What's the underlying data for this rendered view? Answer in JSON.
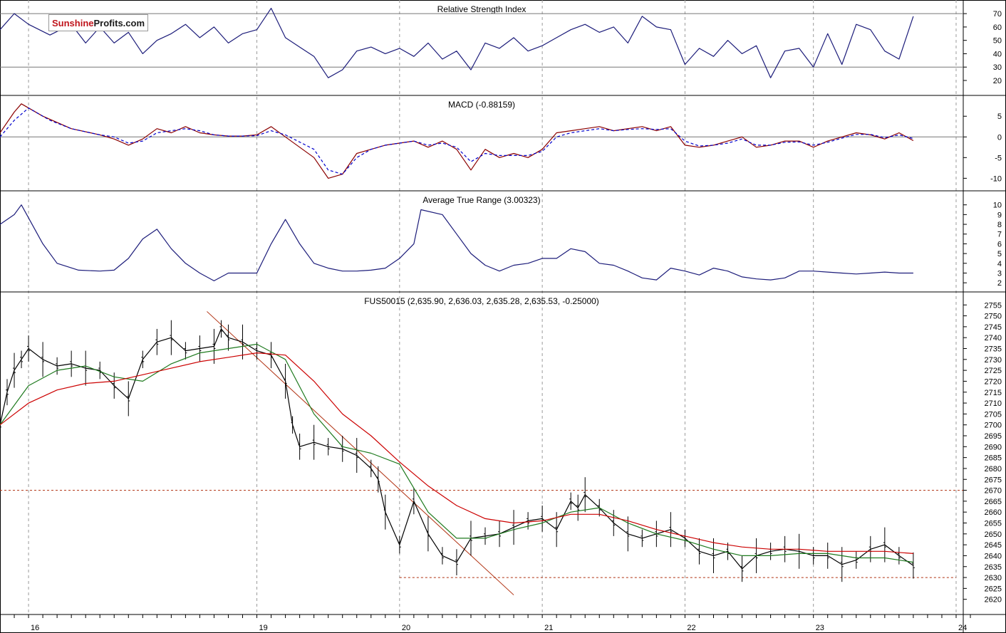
{
  "brand": {
    "logo_part1": "Sunshine",
    "logo_part2": "Profits.com"
  },
  "colors": {
    "rsi_line": "#1c1c7a",
    "macd_line": "#8b0000",
    "signal_line": "#0000cc",
    "atr_line": "#1c1c7a",
    "price_bars": "#000000",
    "ma_short": "#1e7a1e",
    "ma_long": "#cc0000",
    "trendline": "#b03010",
    "support": "#b03010",
    "grid": "#9a9a9a"
  },
  "x_axis": {
    "day_labels": [
      "16",
      "19",
      "20",
      "21",
      "22",
      "23",
      "24"
    ],
    "day_positions": [
      0.2,
      1.8,
      2.8,
      3.8,
      4.8,
      5.7,
      6.7
    ]
  },
  "chart_data": [
    {
      "type": "line",
      "title": "Relative Strength Index",
      "ylim": [
        12,
        77
      ],
      "yticks": [
        70,
        60,
        50,
        40,
        30,
        20
      ],
      "reference_lines": [
        70,
        30
      ],
      "series": [
        {
          "x": [
            0.0,
            0.1,
            0.2,
            0.35,
            0.5,
            0.6,
            0.7,
            0.8,
            0.9,
            1.0,
            1.1,
            1.2,
            1.3,
            1.4,
            1.5,
            1.6,
            1.7,
            1.8,
            1.9,
            2.0,
            2.1,
            2.2,
            2.3,
            2.4,
            2.5,
            2.6,
            2.7,
            2.8,
            2.9,
            3.0,
            3.1,
            3.2,
            3.3,
            3.4,
            3.5,
            3.6,
            3.7,
            3.8,
            3.9,
            4.0,
            4.1,
            4.2,
            4.3,
            4.4,
            4.5,
            4.6,
            4.7,
            4.8,
            4.9,
            5.0,
            5.1,
            5.2,
            5.3,
            5.4,
            5.5,
            5.6,
            5.7,
            5.8,
            5.9,
            6.0,
            6.1,
            6.2,
            6.3,
            6.4
          ],
          "values": [
            58,
            70,
            62,
            54,
            62,
            48,
            60,
            48,
            56,
            40,
            50,
            55,
            62,
            52,
            60,
            48,
            55,
            58,
            74,
            52,
            45,
            38,
            22,
            28,
            42,
            45,
            40,
            44,
            38,
            48,
            36,
            42,
            28,
            48,
            44,
            52,
            42,
            46,
            52,
            58,
            62,
            56,
            60,
            48,
            68,
            60,
            58,
            32,
            44,
            38,
            50,
            40,
            46,
            22,
            42,
            44,
            30,
            55,
            32,
            62,
            58,
            42,
            36,
            68
          ]
        }
      ]
    },
    {
      "type": "line",
      "title": "MACD (-0.88159)",
      "ylim": [
        -12,
        9
      ],
      "yticks": [
        5,
        0,
        -5,
        -10
      ],
      "reference_lines": [
        0
      ],
      "series": [
        {
          "x": [
            0.0,
            0.1,
            0.15,
            0.3,
            0.5,
            0.7,
            0.8,
            0.9,
            1.0,
            1.1,
            1.2,
            1.3,
            1.4,
            1.5,
            1.6,
            1.7,
            1.8,
            1.9,
            2.0,
            2.2,
            2.3,
            2.4,
            2.5,
            2.6,
            2.7,
            2.8,
            2.9,
            3.0,
            3.1,
            3.2,
            3.3,
            3.4,
            3.5,
            3.6,
            3.7,
            3.8,
            3.9,
            4.0,
            4.1,
            4.2,
            4.3,
            4.4,
            4.5,
            4.6,
            4.7,
            4.8,
            4.9,
            5.0,
            5.1,
            5.2,
            5.3,
            5.4,
            5.5,
            5.6,
            5.7,
            5.8,
            5.9,
            6.0,
            6.1,
            6.2,
            6.3,
            6.4
          ],
          "values": [
            1,
            6,
            8,
            5,
            2,
            0.5,
            -0.5,
            -2,
            -0.5,
            2,
            1,
            2.5,
            1,
            0.5,
            0.2,
            0.2,
            0.5,
            2.5,
            0,
            -5,
            -10,
            -9,
            -4,
            -3,
            -2,
            -1.5,
            -1,
            -2.5,
            -1,
            -3,
            -8,
            -3,
            -5,
            -4,
            -5,
            -3,
            1,
            1.5,
            2,
            2.5,
            1.5,
            2,
            2.5,
            1.5,
            2.5,
            -2,
            -2.5,
            -2,
            -1,
            0,
            -2.5,
            -2,
            -1,
            -1,
            -2.5,
            -1,
            0,
            1,
            0.5,
            -0.5,
            1,
            -0.9
          ]
        },
        {
          "x": [
            0.0,
            0.1,
            0.2,
            0.35,
            0.5,
            0.7,
            0.8,
            0.9,
            1.0,
            1.1,
            1.2,
            1.3,
            1.4,
            1.5,
            1.6,
            1.7,
            1.8,
            1.9,
            2.0,
            2.2,
            2.3,
            2.4,
            2.5,
            2.6,
            2.7,
            2.8,
            2.9,
            3.0,
            3.1,
            3.2,
            3.3,
            3.4,
            3.5,
            3.6,
            3.7,
            3.8,
            3.9,
            4.0,
            4.1,
            4.2,
            4.3,
            4.4,
            4.5,
            4.6,
            4.7,
            4.8,
            4.9,
            5.0,
            5.1,
            5.2,
            5.3,
            5.4,
            5.5,
            5.6,
            5.7,
            5.8,
            5.9,
            6.0,
            6.1,
            6.2,
            6.3,
            6.4
          ],
          "values": [
            0,
            4,
            7,
            4,
            2,
            0.5,
            0,
            -1.5,
            -1,
            1,
            1.5,
            2,
            1.5,
            0.5,
            0.2,
            0.2,
            0.3,
            1.5,
            0.5,
            -3,
            -8,
            -9,
            -5,
            -3,
            -2,
            -1.5,
            -1,
            -2,
            -1.5,
            -2.5,
            -6,
            -4,
            -4.5,
            -4.5,
            -4.5,
            -3.5,
            0,
            1,
            1.5,
            2,
            1.5,
            1.8,
            2,
            1.8,
            2,
            -1,
            -2.2,
            -2,
            -1.5,
            -0.5,
            -2,
            -2,
            -1.3,
            -1.2,
            -2,
            -1.3,
            -0.3,
            0.6,
            0.6,
            -0.2,
            0.5,
            -0.4
          ]
        }
      ]
    },
    {
      "type": "line",
      "title": "Average True Range (3.00323)",
      "ylim": [
        1.5,
        11
      ],
      "yticks": [
        10,
        9,
        8,
        7,
        6,
        5,
        4,
        3,
        2
      ],
      "series": [
        {
          "x": [
            0.0,
            0.1,
            0.15,
            0.3,
            0.4,
            0.55,
            0.7,
            0.8,
            0.9,
            1.0,
            1.1,
            1.2,
            1.3,
            1.4,
            1.5,
            1.6,
            1.8,
            1.9,
            2.0,
            2.1,
            2.2,
            2.3,
            2.4,
            2.5,
            2.6,
            2.7,
            2.8,
            2.9,
            2.95,
            3.1,
            3.2,
            3.3,
            3.4,
            3.5,
            3.6,
            3.7,
            3.8,
            3.9,
            4.0,
            4.1,
            4.2,
            4.3,
            4.4,
            4.5,
            4.6,
            4.7,
            4.8,
            4.9,
            5.0,
            5.1,
            5.2,
            5.3,
            5.4,
            5.5,
            5.6,
            5.7,
            5.8,
            5.9,
            6.0,
            6.1,
            6.2,
            6.3,
            6.4
          ],
          "values": [
            8,
            9,
            10,
            6,
            4,
            3.3,
            3.2,
            3.3,
            4.5,
            6.5,
            7.5,
            5.5,
            4,
            3,
            2.2,
            3,
            3,
            6,
            8.5,
            6,
            4,
            3.5,
            3.2,
            3.2,
            3.3,
            3.5,
            4.5,
            6,
            9.5,
            9,
            7,
            5,
            3.8,
            3.2,
            3.8,
            4,
            4.5,
            4.5,
            5.5,
            5.2,
            4,
            3.8,
            3.2,
            2.5,
            2.3,
            3.5,
            3.2,
            2.8,
            3.5,
            3.2,
            2.6,
            2.4,
            2.3,
            2.5,
            3.2,
            3.2,
            3.1,
            3.0,
            2.9,
            3.0,
            3.1,
            3.0,
            3.0
          ]
        }
      ]
    },
    {
      "type": "line",
      "title": "FUS50015 (2,635.90, 2,636.03, 2,635.28, 2,635.53, -0.25000)",
      "ylim": [
        2615,
        2759
      ],
      "yticks": [
        2755,
        2750,
        2745,
        2740,
        2735,
        2730,
        2725,
        2720,
        2715,
        2710,
        2705,
        2700,
        2695,
        2690,
        2685,
        2680,
        2675,
        2670,
        2665,
        2660,
        2655,
        2650,
        2645,
        2640,
        2635,
        2630,
        2625,
        2620
      ],
      "reference_lines": [
        2670
      ],
      "support_line": {
        "x": [
          2.8,
          6.7
        ],
        "y": 2630
      },
      "trendline": {
        "x": [
          1.45,
          3.6
        ],
        "y": [
          2752,
          2622
        ]
      },
      "series": [
        {
          "name": "price",
          "x": [
            0.0,
            0.05,
            0.1,
            0.15,
            0.2,
            0.3,
            0.4,
            0.5,
            0.6,
            0.7,
            0.8,
            0.9,
            1.0,
            1.1,
            1.2,
            1.3,
            1.4,
            1.5,
            1.55,
            1.6,
            1.7,
            1.8,
            1.9,
            2.0,
            2.05,
            2.1,
            2.2,
            2.3,
            2.4,
            2.5,
            2.6,
            2.65,
            2.7,
            2.8,
            2.9,
            3.0,
            3.1,
            3.2,
            3.3,
            3.4,
            3.5,
            3.6,
            3.7,
            3.8,
            3.9,
            4.0,
            4.05,
            4.1,
            4.2,
            4.3,
            4.4,
            4.5,
            4.6,
            4.7,
            4.8,
            4.9,
            5.0,
            5.1,
            5.2,
            5.3,
            5.4,
            5.5,
            5.6,
            5.7,
            5.8,
            5.9,
            6.0,
            6.1,
            6.2,
            6.3,
            6.4
          ],
          "values": [
            2700,
            2715,
            2725,
            2730,
            2735,
            2730,
            2727,
            2728,
            2726,
            2725,
            2718,
            2712,
            2730,
            2738,
            2740,
            2734,
            2735,
            2736,
            2744,
            2740,
            2738,
            2734,
            2732,
            2720,
            2700,
            2690,
            2692,
            2690,
            2689,
            2686,
            2680,
            2675,
            2660,
            2645,
            2665,
            2650,
            2640,
            2637,
            2648,
            2649,
            2650,
            2653,
            2656,
            2657,
            2652,
            2665,
            2662,
            2668,
            2662,
            2655,
            2650,
            2648,
            2650,
            2652,
            2648,
            2642,
            2640,
            2642,
            2634,
            2640,
            2642,
            2643,
            2642,
            2640,
            2640,
            2636,
            2638,
            2643,
            2645,
            2640,
            2635.5
          ]
        },
        {
          "name": "ma-short",
          "x": [
            0.0,
            0.2,
            0.4,
            0.6,
            0.8,
            1.0,
            1.2,
            1.4,
            1.6,
            1.8,
            2.0,
            2.2,
            2.4,
            2.6,
            2.8,
            3.0,
            3.2,
            3.4,
            3.6,
            3.8,
            4.0,
            4.2,
            4.4,
            4.6,
            4.8,
            5.0,
            5.2,
            5.4,
            5.6,
            5.8,
            6.0,
            6.2,
            6.4
          ],
          "values": [
            2700,
            2718,
            2725,
            2727,
            2722,
            2720,
            2728,
            2733,
            2735,
            2737,
            2730,
            2705,
            2690,
            2687,
            2682,
            2660,
            2648,
            2648,
            2652,
            2655,
            2660,
            2662,
            2655,
            2650,
            2647,
            2643,
            2640,
            2640,
            2641,
            2641,
            2639,
            2639,
            2637
          ]
        },
        {
          "name": "ma-long",
          "x": [
            0.0,
            0.2,
            0.4,
            0.6,
            0.8,
            1.0,
            1.2,
            1.4,
            1.6,
            1.8,
            2.0,
            2.2,
            2.4,
            2.6,
            2.8,
            3.0,
            3.2,
            3.4,
            3.6,
            3.8,
            4.0,
            4.2,
            4.4,
            4.6,
            4.8,
            5.0,
            5.2,
            5.4,
            5.6,
            5.8,
            6.0,
            6.2,
            6.4
          ],
          "values": [
            2700,
            2710,
            2716,
            2719,
            2720,
            2723,
            2726,
            2729,
            2731,
            2733,
            2732,
            2720,
            2705,
            2695,
            2683,
            2672,
            2663,
            2657,
            2655,
            2656,
            2659,
            2659,
            2656,
            2652,
            2649,
            2646,
            2644,
            2643,
            2643,
            2642,
            2642,
            2642,
            2641
          ]
        }
      ]
    }
  ]
}
